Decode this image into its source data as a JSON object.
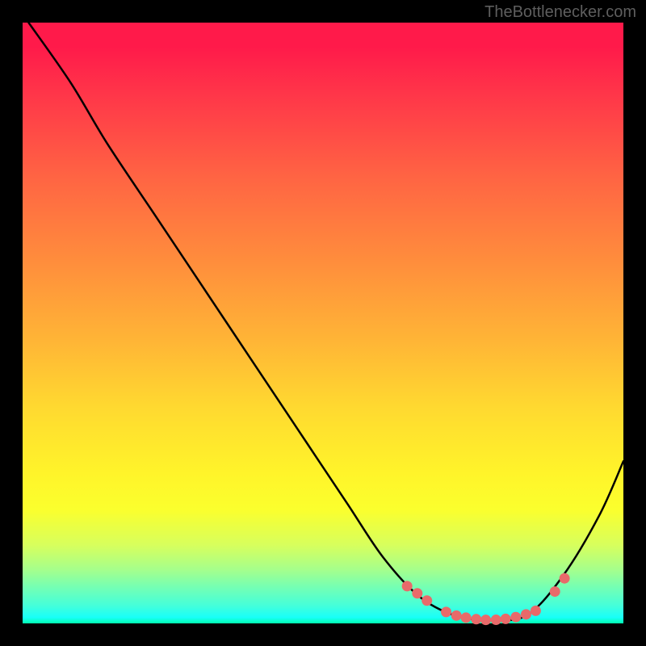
{
  "watermark": "TheBottlenecker.com",
  "chart_data": {
    "type": "line",
    "title": "",
    "xlabel": "",
    "ylabel": "",
    "xlim": [
      0,
      100
    ],
    "ylim": [
      0,
      100
    ],
    "curve": [
      {
        "x": 1,
        "y": 100
      },
      {
        "x": 8,
        "y": 90
      },
      {
        "x": 14,
        "y": 80
      },
      {
        "x": 22,
        "y": 68
      },
      {
        "x": 30,
        "y": 56
      },
      {
        "x": 38,
        "y": 44
      },
      {
        "x": 46,
        "y": 32
      },
      {
        "x": 54,
        "y": 20
      },
      {
        "x": 60,
        "y": 11
      },
      {
        "x": 66,
        "y": 4.5
      },
      {
        "x": 72,
        "y": 1.3
      },
      {
        "x": 78,
        "y": 0.6
      },
      {
        "x": 84,
        "y": 1.4
      },
      {
        "x": 90,
        "y": 8
      },
      {
        "x": 96,
        "y": 18
      },
      {
        "x": 100,
        "y": 27
      }
    ],
    "points": [
      {
        "x": 64,
        "y": 6.2
      },
      {
        "x": 65.7,
        "y": 5.0
      },
      {
        "x": 67.3,
        "y": 3.8
      },
      {
        "x": 70.5,
        "y": 1.9
      },
      {
        "x": 72.2,
        "y": 1.3
      },
      {
        "x": 73.8,
        "y": 0.95
      },
      {
        "x": 75.5,
        "y": 0.7
      },
      {
        "x": 77.1,
        "y": 0.58
      },
      {
        "x": 78.8,
        "y": 0.6
      },
      {
        "x": 80.4,
        "y": 0.75
      },
      {
        "x": 82.1,
        "y": 1.05
      },
      {
        "x": 83.8,
        "y": 1.5
      },
      {
        "x": 85.4,
        "y": 2.1
      },
      {
        "x": 88.6,
        "y": 5.3
      },
      {
        "x": 90.2,
        "y": 7.5
      }
    ],
    "gradient_stops": [
      {
        "pos": 0,
        "color": "#ff1a4a"
      },
      {
        "pos": 50,
        "color": "#ffc432"
      },
      {
        "pos": 80,
        "color": "#f7ff2c"
      },
      {
        "pos": 100,
        "color": "#00ffb0"
      }
    ]
  }
}
